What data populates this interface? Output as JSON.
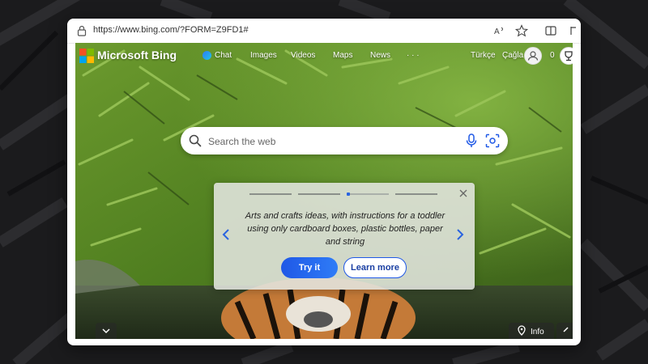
{
  "browser": {
    "url": "https://www.bing.com/?FORM=Z9FD1#",
    "toolbar_icons": [
      "read-aloud-icon",
      "favorite-star-icon",
      "split-screen-icon",
      "favorites-icon"
    ]
  },
  "header": {
    "brand": "Microsoft Bing",
    "nav": {
      "chat": "Chat",
      "images": "Images",
      "videos": "Videos",
      "maps": "Maps",
      "news": "News",
      "more": "· · ·"
    },
    "language": "Türkçe",
    "user_name": "Çağla",
    "rewards_count": "0"
  },
  "search": {
    "placeholder": "Search the web"
  },
  "prompt_card": {
    "text": "Arts and crafts ideas, with instructions for a toddler using only cardboard boxes, plastic bottles, paper and string",
    "try_label": "Try it",
    "learn_label": "Learn more",
    "active_step": 3,
    "total_steps": 4
  },
  "footer": {
    "info_label": "Info"
  },
  "colors": {
    "accent": "#2a64e0",
    "try_button": "#1f58e6",
    "background": "#1b1b1d"
  }
}
